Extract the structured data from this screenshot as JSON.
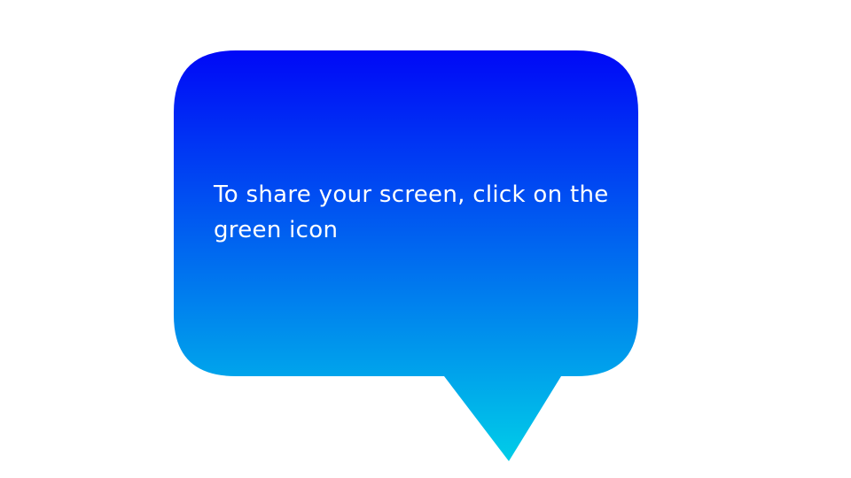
{
  "speech_bubble": {
    "message": "To share your screen, click on the green icon",
    "gradient_top_color": "#0008F7",
    "gradient_bottom_color": "#00CDE8",
    "text_color": "#FFFFFF"
  }
}
